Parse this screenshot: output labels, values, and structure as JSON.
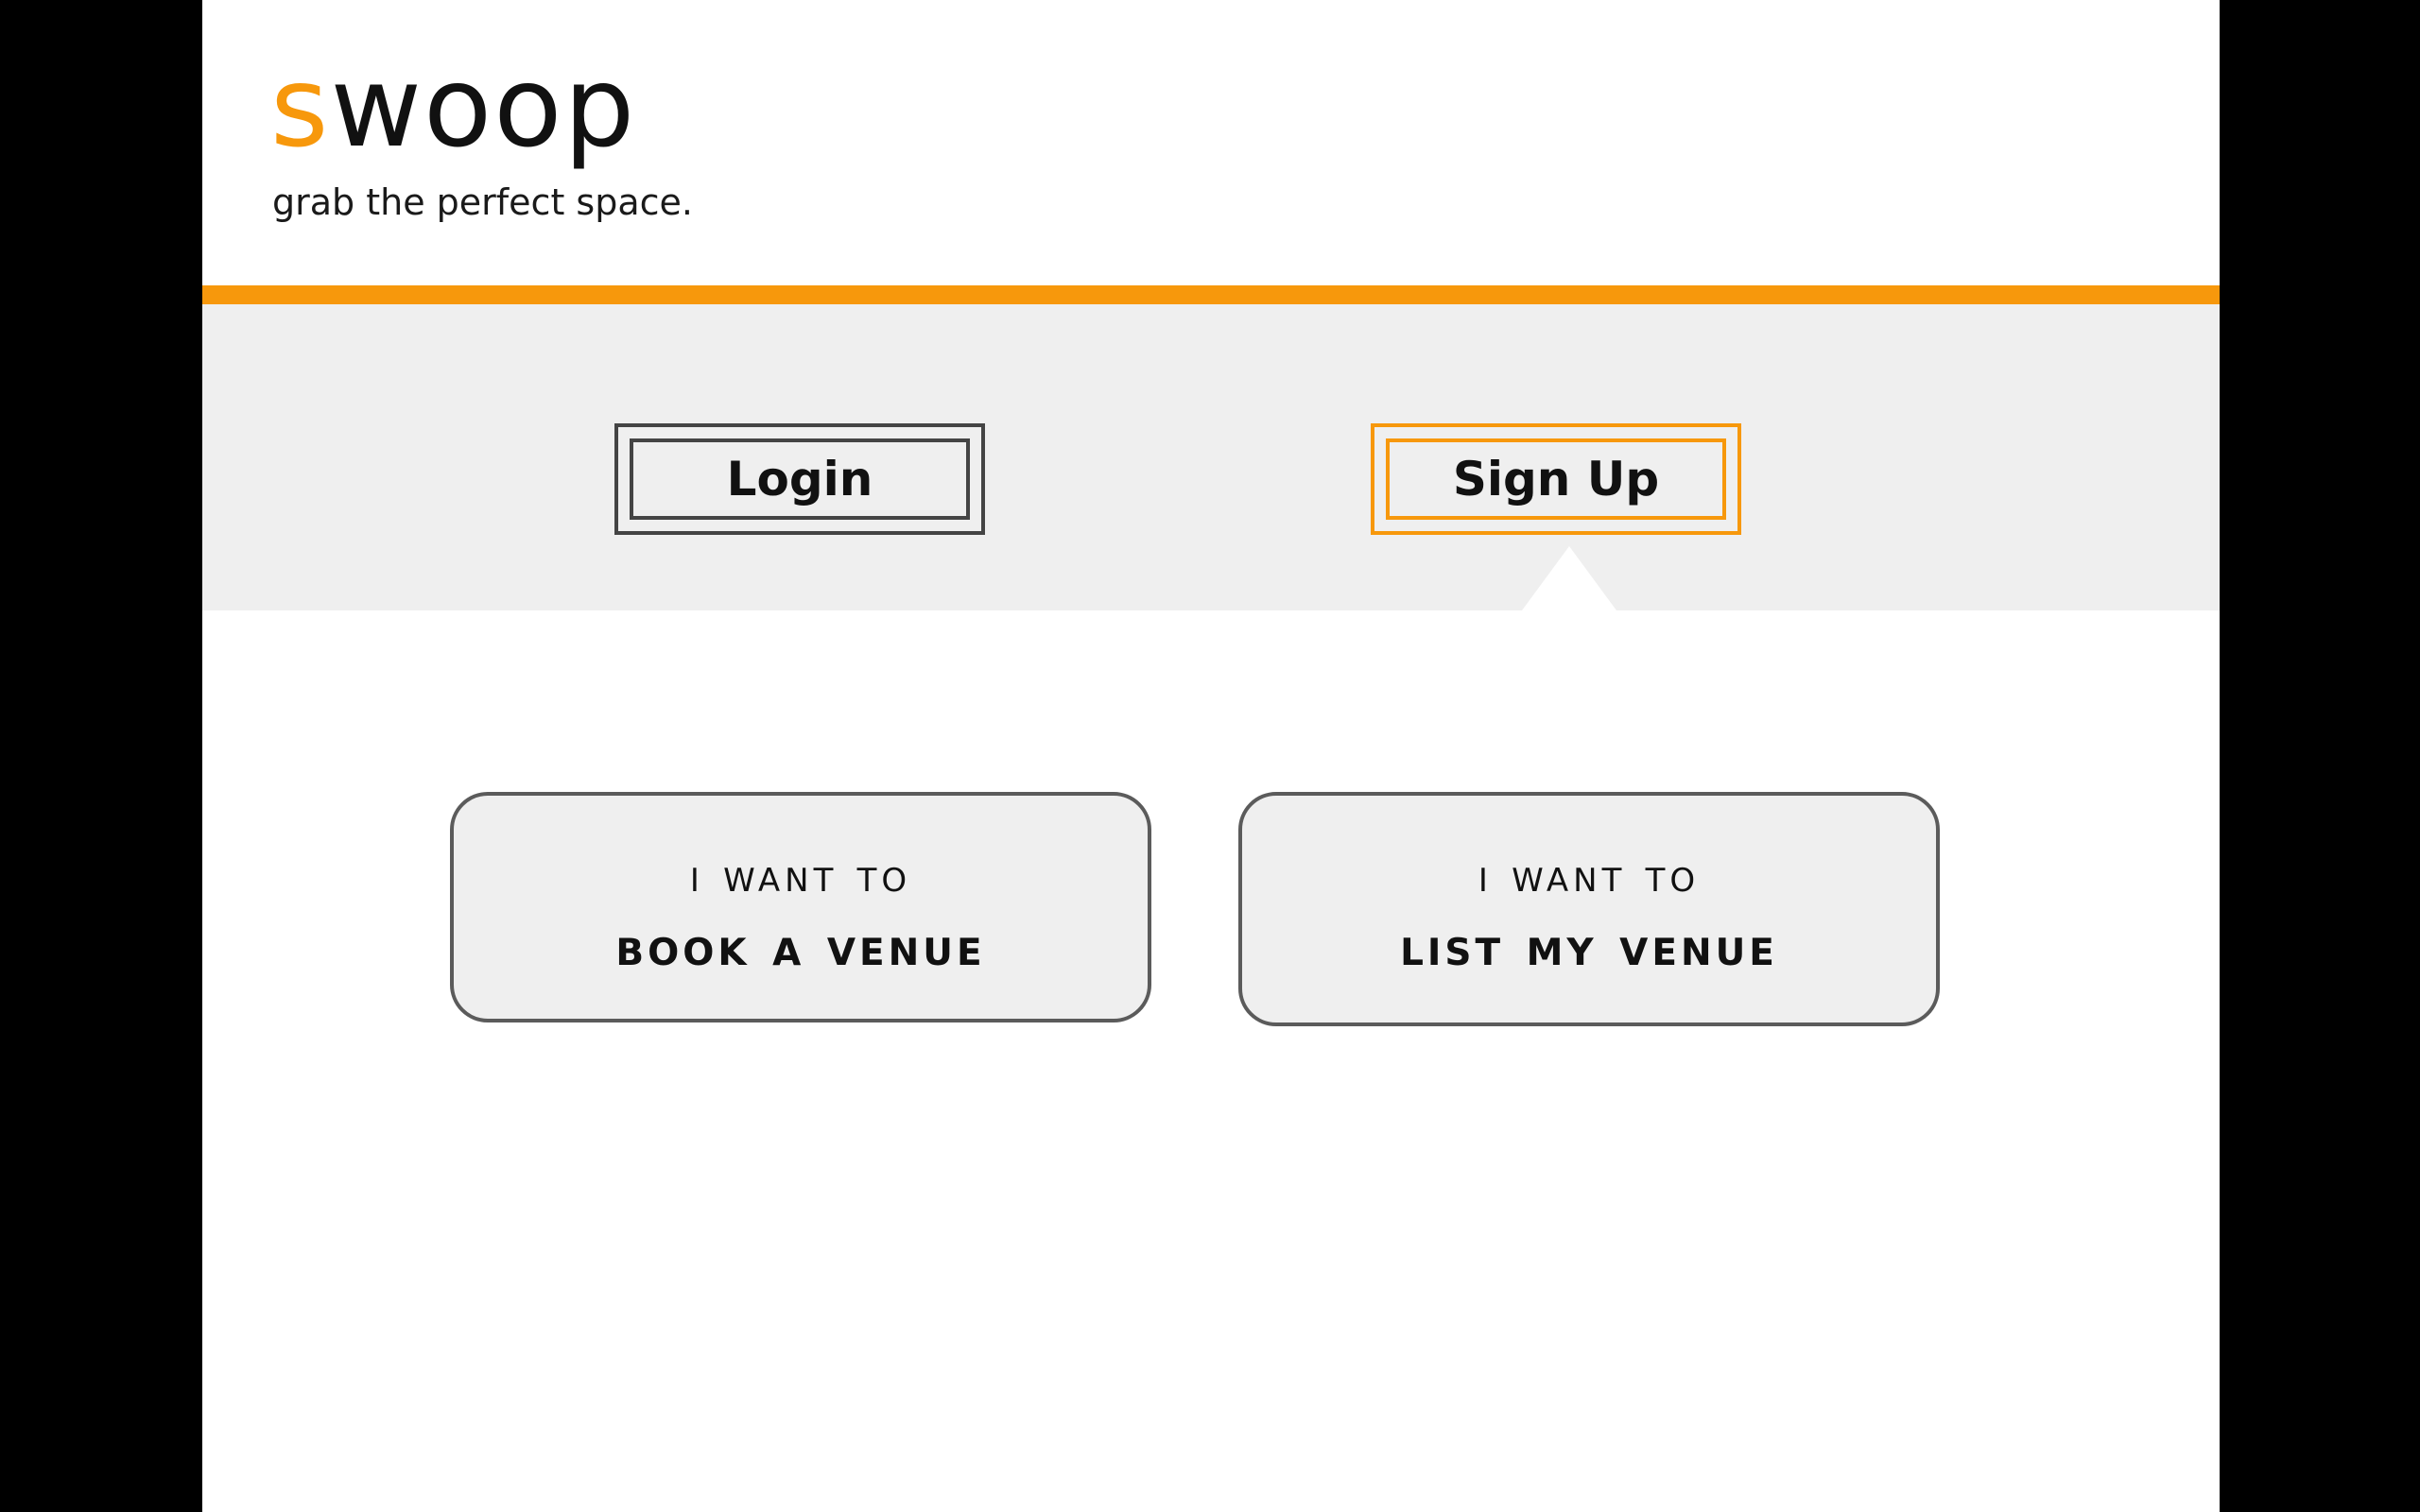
{
  "header": {
    "logo_accent": "s",
    "logo_rest": "woop",
    "tagline": "grab the perfect space."
  },
  "auth": {
    "login_label": "Login",
    "signup_label": "Sign Up",
    "selected": "Sign Up"
  },
  "choices": [
    {
      "line1": "I want to",
      "line2": "Book a venue"
    },
    {
      "line1": "I want to",
      "line2": "List my venue"
    }
  ],
  "colors": {
    "accent": "#f7980c",
    "band": "#efefef",
    "frame": "#000000",
    "border_dark": "#444444"
  }
}
